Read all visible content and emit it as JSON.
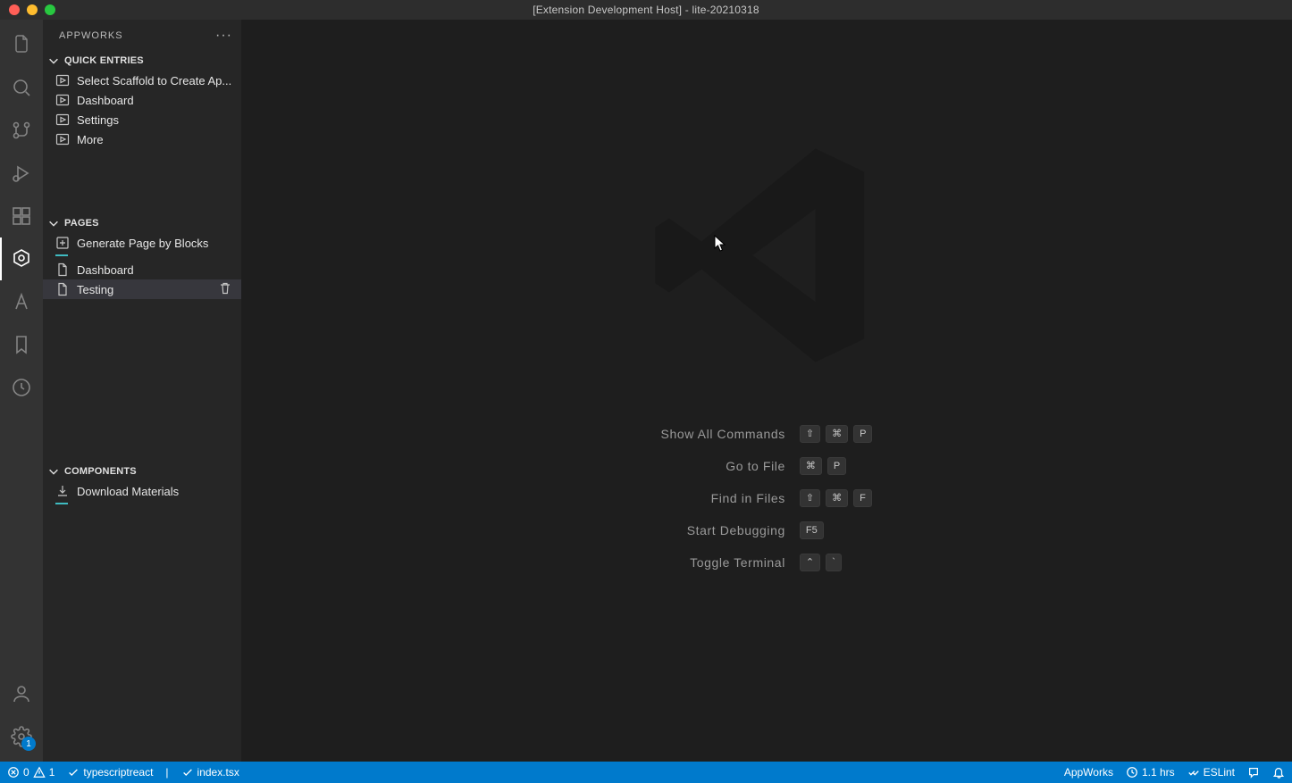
{
  "window": {
    "title": "[Extension Development Host] - lite-20210318"
  },
  "sidebar": {
    "title": "APPWORKS",
    "sections": {
      "quick": {
        "label": "QUICK ENTRIES",
        "items": [
          {
            "label": "Select Scaffold to Create Ap..."
          },
          {
            "label": "Dashboard"
          },
          {
            "label": "Settings"
          },
          {
            "label": "More"
          }
        ]
      },
      "pages": {
        "label": "PAGES",
        "action": "Generate Page by Blocks",
        "items": [
          {
            "label": "Dashboard"
          },
          {
            "label": "Testing"
          }
        ]
      },
      "components": {
        "label": "COMPONENTS",
        "action": "Download Materials"
      }
    }
  },
  "activitybar": {
    "settings_badge": "1"
  },
  "welcome": {
    "shortcuts": [
      {
        "label": "Show All Commands",
        "keys": [
          "⇧",
          "⌘",
          "P"
        ]
      },
      {
        "label": "Go to File",
        "keys": [
          "⌘",
          "P"
        ]
      },
      {
        "label": "Find in Files",
        "keys": [
          "⇧",
          "⌘",
          "F"
        ]
      },
      {
        "label": "Start Debugging",
        "keys": [
          "F5"
        ]
      },
      {
        "label": "Toggle Terminal",
        "keys": [
          "⌃",
          "`"
        ]
      }
    ]
  },
  "status": {
    "errors": "0",
    "warnings": "1",
    "lang": "typescriptreact",
    "file": "index.tsx",
    "appworks": "AppWorks",
    "time": "1.1 hrs",
    "eslint": "ESLint"
  }
}
